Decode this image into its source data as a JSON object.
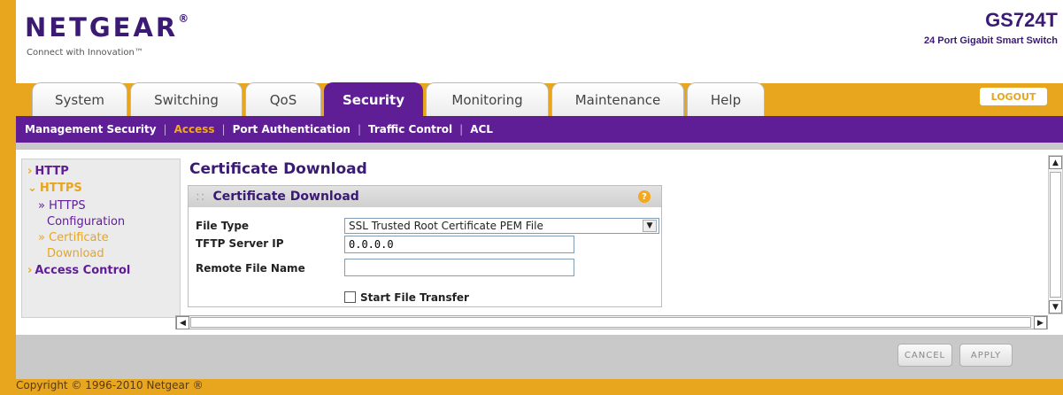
{
  "brand": {
    "logo": "NETGEAR",
    "tagline": "Connect with Innovation™",
    "model": "GS724T",
    "model_desc": "24 Port Gigabit Smart Switch"
  },
  "tabs": [
    {
      "label": "System"
    },
    {
      "label": "Switching"
    },
    {
      "label": "QoS"
    },
    {
      "label": "Security"
    },
    {
      "label": "Monitoring"
    },
    {
      "label": "Maintenance"
    },
    {
      "label": "Help"
    }
  ],
  "logout_label": "LOGOUT",
  "subnav": [
    {
      "label": "Management Security"
    },
    {
      "label": "Access"
    },
    {
      "label": "Port Authentication"
    },
    {
      "label": "Traffic Control"
    },
    {
      "label": "ACL"
    }
  ],
  "leftnav": {
    "http": "HTTP",
    "https": "HTTPS",
    "https_config_1": "» HTTPS",
    "https_config_2": "Configuration",
    "cert_dl_1": "» Certificate",
    "cert_dl_2": "Download",
    "access_control": "Access Control"
  },
  "page_title": "Certificate Download",
  "panel": {
    "title": "Certificate Download",
    "help_icon": "?",
    "file_type_label": "File Type",
    "file_type_value": "SSL Trusted Root Certificate PEM File",
    "tftp_label": "TFTP Server IP",
    "tftp_value": "0.0.0.0",
    "remote_file_label": "Remote File Name",
    "remote_file_value": "",
    "start_transfer_label": "Start File Transfer"
  },
  "buttons": {
    "cancel": "CANCEL",
    "apply": "APPLY"
  },
  "copyright": "Copyright © 1996-2010 Netgear ®",
  "colors": {
    "purple": "#5f1d96",
    "orange": "#e8a51e",
    "navy": "#3b1a74"
  }
}
